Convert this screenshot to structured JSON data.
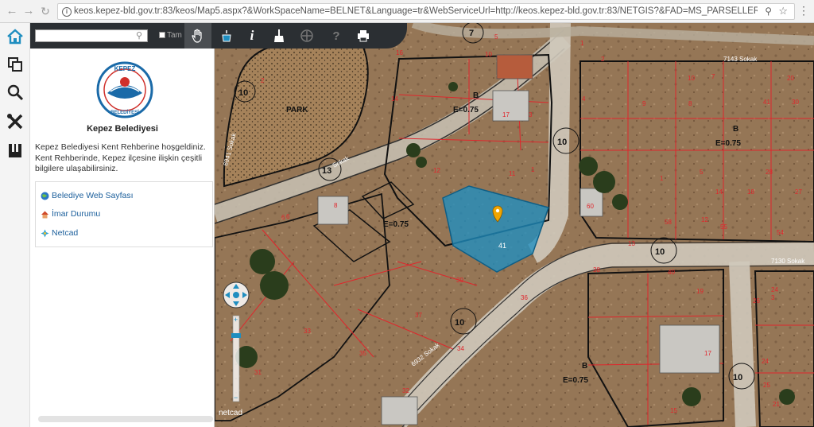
{
  "browser": {
    "url": "keos.kepez-bld.gov.tr:83/keos/Map5.aspx?&WorkSpaceName=BELNET&Language=tr&WebServiceUrl=http://keos.kepez-bld.gov.tr:83/NETGIS?&FAD=MS_PARSELLER.BELNET.MS_PA...",
    "back_icon": "arrow-left",
    "forward_icon": "arrow-right",
    "reload_icon": "reload"
  },
  "sidebar": {
    "items": [
      {
        "name": "home",
        "icon": "home-icon"
      },
      {
        "name": "layers",
        "icon": "layers-icon"
      },
      {
        "name": "search",
        "icon": "search-icon"
      },
      {
        "name": "tools",
        "icon": "tools-icon"
      },
      {
        "name": "bookmark",
        "icon": "bookmark-icon"
      }
    ]
  },
  "panel": {
    "search_placeholder": "",
    "tam_label": "Tam",
    "org_name": "Kepez Belediyesi",
    "logo_text": "KEPEZ BELEDİYESİ",
    "welcome_text": "Kepez Belediyesi Kent Rehberine hoşgeldiniz. Kent Rehberinde, Kepez ilçesine ilişkin çeşitli bilgilere ulaşabilirsiniz.",
    "links": [
      {
        "label": "Belediye Web Sayfası",
        "icon": "globe-icon"
      },
      {
        "label": "İmar Durumu",
        "icon": "house-icon"
      },
      {
        "label": "Netcad",
        "icon": "netcad-icon"
      }
    ]
  },
  "toolbar": {
    "tools": [
      {
        "name": "pan",
        "icon": "hand-icon",
        "active": true
      },
      {
        "name": "fill",
        "icon": "bucket-icon"
      },
      {
        "name": "info",
        "icon": "info-icon"
      },
      {
        "name": "clear",
        "icon": "broom-icon"
      },
      {
        "name": "navigate",
        "icon": "compass-icon"
      },
      {
        "name": "help",
        "icon": "help-icon"
      },
      {
        "name": "print",
        "icon": "print-icon"
      }
    ]
  },
  "map": {
    "watermark": "netcad",
    "labels": {
      "park": "PARK",
      "zone_b": "B",
      "e_075": "E=0.75",
      "e_075_short": "E=0.75",
      "street_6941": "6941 Sokak",
      "street_6932": "6932 Sokak",
      "street_7143": "7143 Sokak",
      "street_7130": "7130 Sokak",
      "street_sokak": "Sokak"
    },
    "road_widths": [
      "7",
      "10",
      "10",
      "10",
      "10",
      "13",
      "10"
    ],
    "parcel_numbers": [
      "16",
      "6",
      "2",
      "14",
      "10",
      "17",
      "3",
      "1",
      "12",
      "5",
      "11",
      "8",
      "6",
      "40",
      "60",
      "58",
      "55",
      "54",
      "38",
      "39",
      "36",
      "37",
      "34",
      "35",
      "33",
      "31",
      "32",
      "15",
      "17",
      "19",
      "26",
      "24",
      "25",
      "21",
      "4",
      "2",
      "9",
      "8",
      "1",
      "10",
      "13",
      "14",
      "12",
      "5",
      "18",
      "28",
      "27",
      "30",
      "20",
      "41",
      "1",
      "3",
      "24",
      "7"
    ],
    "accent": "#1f8ec0",
    "marker_color": "#f0a500",
    "parcel_line": "#e0262c"
  }
}
